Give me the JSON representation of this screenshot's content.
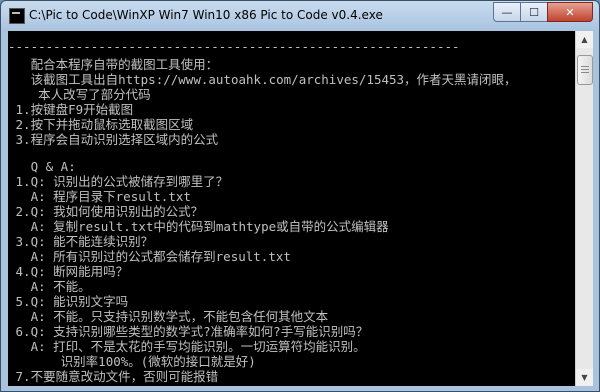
{
  "window": {
    "title": "C:\\Pic to Code\\WinXP Win7 Win10 x86 Pic to Code v0.4.exe",
    "controls": {
      "minimize": "—",
      "maximize": "☐",
      "close": "✕"
    }
  },
  "console": {
    "lines": [
      "------------------------------------------------------------",
      "   配合本程序自带的截图工具使用：",
      "   该截图工具出自https://www.autoahk.com/archives/15453，作者天黑请闭眼，",
      "    本人改写了部分代码",
      " 1.按键盘F9开始截图",
      " 2.按下并拖动鼠标选取截图区域",
      " 3.程序会自动识别选择区域内的公式",
      "",
      "   Q & A:",
      " 1.Q: 识别出的公式被储存到哪里了？",
      "   A: 程序目录下result.txt",
      " 2.Q: 我如何使用识别出的公式？",
      "   A: 复制result.txt中的代码到mathtype或自带的公式编辑器",
      " 3.Q: 能不能连续识别？",
      "   A: 所有识别过的公式都会储存到result.txt",
      " 4.Q: 断网能用吗？",
      "   A: 不能。",
      " 5.Q: 能识别文字吗",
      "   A: 不能。只支持识别数学式，不能包含任何其他文本",
      " 6.Q: 支持识别哪些类型的数学式?准确率如何?手写能识别吗？",
      "   A: 打印、不是太花的手写均能识别。一切运算符均能识别。",
      "       识别率100%。(微软的接口就是好)",
      " 7.不要随意改动文件，否则可能报错"
    ]
  },
  "scrollbar": {
    "up_arrow": "▲",
    "down_arrow": "▼"
  }
}
